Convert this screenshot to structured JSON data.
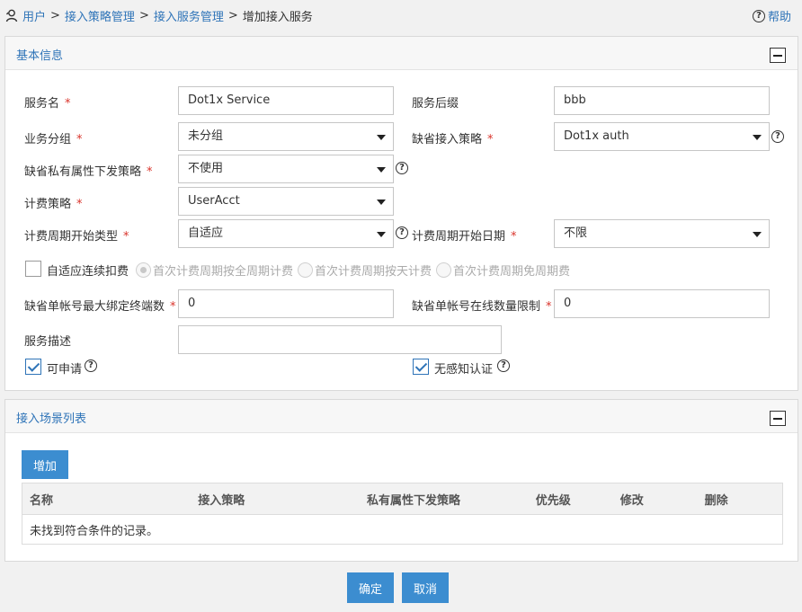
{
  "breadcrumb": {
    "items": [
      "用户",
      "接入策略管理",
      "接入服务管理"
    ],
    "current": "增加接入服务"
  },
  "help": {
    "label": "帮助"
  },
  "basic": {
    "title": "基本信息",
    "service_name": {
      "label": "服务名",
      "value": "Dot1x Service"
    },
    "service_suffix": {
      "label": "服务后缀",
      "value": "bbb"
    },
    "business_group": {
      "label": "业务分组",
      "value": "未分组"
    },
    "default_access_policy": {
      "label": "缺省接入策略",
      "value": "Dot1x auth"
    },
    "default_private_attr": {
      "label": "缺省私有属性下发策略",
      "value": "不使用"
    },
    "billing_policy": {
      "label": "计费策略",
      "value": "UserAcct"
    },
    "billing_cycle_type": {
      "label": "计费周期开始类型",
      "value": "自适应"
    },
    "billing_cycle_date": {
      "label": "计费周期开始日期",
      "value": "不限"
    },
    "adaptive_deduct": {
      "label": "自适应连续扣费",
      "checked": false
    },
    "radios": [
      "首次计费周期按全周期计费",
      "首次计费周期按天计费",
      "首次计费周期免周期费"
    ],
    "max_bind_terminals": {
      "label": "缺省单帐号最大绑定终端数",
      "value": "0"
    },
    "online_limit": {
      "label": "缺省单帐号在线数量限制",
      "value": "0"
    },
    "description": {
      "label": "服务描述",
      "value": ""
    },
    "applicable": {
      "label": "可申请",
      "checked": true
    },
    "seamless_auth": {
      "label": "无感知认证",
      "checked": true
    },
    "required_mark": "*"
  },
  "scene": {
    "title": "接入场景列表",
    "add_button": "增加",
    "columns": [
      "名称",
      "接入策略",
      "私有属性下发策略",
      "优先级",
      "修改",
      "删除"
    ],
    "empty_text": "未找到符合条件的记录。"
  },
  "footer": {
    "ok": "确定",
    "cancel": "取消"
  },
  "colors": {
    "accent": "#3c8dd0",
    "link": "#2f74b8",
    "required": "#d9332b"
  },
  "icons": [
    "user-icon",
    "help-icon",
    "collapse-icon",
    "caret-down-icon",
    "question-icon",
    "checkmark-icon"
  ]
}
